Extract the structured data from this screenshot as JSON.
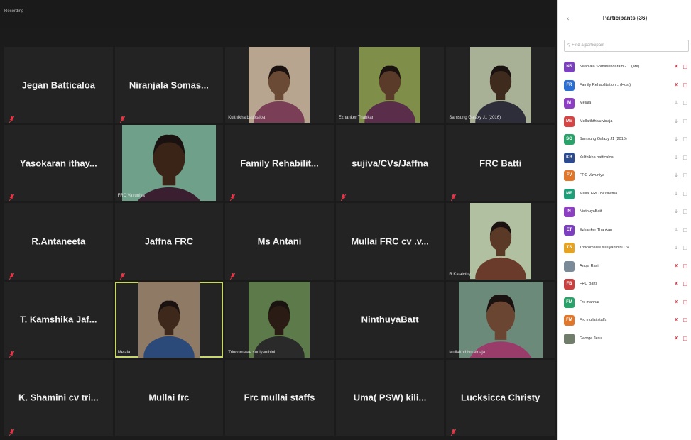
{
  "topbar": {
    "recording_label": "Recording"
  },
  "tiles": [
    {
      "name": "Jegan Batticaloa",
      "caption": "",
      "video": false,
      "muted": true
    },
    {
      "name": "Niranjala  Somas...",
      "caption": "",
      "video": false,
      "muted": true
    },
    {
      "name": "",
      "caption": "Kulthikha  batticaloa",
      "video": true,
      "muted": false,
      "skin": "#6a4a35",
      "bg": "#b8a58f",
      "shirt": "#7a3f57",
      "size": "narrow"
    },
    {
      "name": "",
      "caption": "Ezhanker Thankan",
      "video": true,
      "muted": false,
      "skin": "#5a3a28",
      "bg": "#7f8f4a",
      "shirt": "#5a2d4a",
      "size": "narrow"
    },
    {
      "name": "",
      "caption": "Samsung Galaxy J1 (2016)",
      "video": true,
      "muted": false,
      "skin": "#3f2a1e",
      "bg": "#a8b095",
      "shirt": "#2e2e3a",
      "size": "narrow"
    },
    {
      "name": "Yasokaran  ithay...",
      "caption": "",
      "video": false,
      "muted": true
    },
    {
      "name": "",
      "caption": "FRC Vavuniya",
      "video": true,
      "muted": false,
      "skin": "#3a2418",
      "bg": "#6fa08a",
      "shirt": "#3a1f30",
      "size": "wide"
    },
    {
      "name": "Family  Rehabilit...",
      "caption": "",
      "video": false,
      "muted": true
    },
    {
      "name": "sujiva/CVs/Jaffna",
      "caption": "",
      "video": false,
      "muted": true
    },
    {
      "name": "FRC Batti",
      "caption": "",
      "video": false,
      "muted": true
    },
    {
      "name": "R.Antaneeta",
      "caption": "",
      "video": false,
      "muted": true
    },
    {
      "name": "Jaffna FRC",
      "caption": "",
      "video": false,
      "muted": true
    },
    {
      "name": "Ms Antani",
      "caption": "",
      "video": false,
      "muted": true
    },
    {
      "name": "Mullai FRC cv .v...",
      "caption": "",
      "video": false,
      "muted": false
    },
    {
      "name": "",
      "caption": "R.Kalaivthy",
      "video": true,
      "muted": true,
      "skin": "#5a3a26",
      "bg": "#b0c0a0",
      "shirt": "#6a3a2a",
      "size": "narrow"
    },
    {
      "name": "T.  Kamshika  Jaf...",
      "caption": "",
      "video": false,
      "muted": true
    },
    {
      "name": "",
      "caption": "Melala",
      "video": true,
      "muted": false,
      "skin": "#3e281b",
      "bg": "#8f7a66",
      "shirt": "#2b4a7a",
      "size": "narrow",
      "active": true
    },
    {
      "name": "",
      "caption": "Trincomalee  suuiyanthini",
      "video": true,
      "muted": false,
      "skin": "#2a1c15",
      "bg": "#5d7a4a",
      "shirt": "#2a2a2a",
      "size": "narrow"
    },
    {
      "name": "NinthuyaBatt",
      "caption": "",
      "video": false,
      "muted": false
    },
    {
      "name": "",
      "caption": "Mullaiththivu vinaja",
      "video": true,
      "muted": false,
      "skin": "#6a4532",
      "bg": "#6c8a7a",
      "shirt": "#9a3c6a",
      "size": "mid"
    },
    {
      "name": "K.  Shamini  cv  tri...",
      "caption": "",
      "video": false,
      "muted": true
    },
    {
      "name": "Mullai frc",
      "caption": "",
      "video": false,
      "muted": false
    },
    {
      "name": "Frc mullai staffs",
      "caption": "",
      "video": false,
      "muted": false
    },
    {
      "name": "Uma( PSW)  kili...",
      "caption": "",
      "video": false,
      "muted": false
    },
    {
      "name": "Lucksicca Christy",
      "caption": "",
      "video": false,
      "muted": true
    }
  ],
  "panel": {
    "back_icon": "chevron-left-icon",
    "title": "Participants (36)",
    "search_placeholder": "Find a participant",
    "participants": [
      {
        "initials": "NS",
        "name": "Niranjala Somasundaram - ...  (Me)",
        "color": "#7b3fbf",
        "muted": true
      },
      {
        "initials": "FR",
        "name": "Family Rehabilitation...  (Host)",
        "color": "#2b6fd4",
        "muted": true
      },
      {
        "initials": "M",
        "name": "Melala",
        "color": "#8c3fc2",
        "muted": false
      },
      {
        "initials": "MV",
        "name": "Mullaiththivu vinaja",
        "color": "#d64545",
        "muted": false
      },
      {
        "initials": "SG",
        "name": "Samsung Galaxy J1 (2016)",
        "color": "#2aa36a",
        "muted": false
      },
      {
        "initials": "KB",
        "name": "Kulthikha  batticaloa",
        "color": "#2c4b8f",
        "muted": false
      },
      {
        "initials": "FV",
        "name": "FRC Vavuniya",
        "color": "#e0772a",
        "muted": false
      },
      {
        "initials": "MF",
        "name": "Mullai FRC cv vavitha",
        "color": "#1f9e7a",
        "muted": false
      },
      {
        "initials": "N",
        "name": "NinthuyaBatt",
        "color": "#8c3fc2",
        "muted": false
      },
      {
        "initials": "ET",
        "name": "Ezhanker Thankan",
        "color": "#7b3fbf",
        "muted": false
      },
      {
        "initials": "TS",
        "name": "Trincomalee suuiyanthini CV",
        "color": "#e6a323",
        "muted": false
      },
      {
        "initials": "",
        "name": "Anuja Ravi",
        "color": "#7a8a99",
        "muted": true
      },
      {
        "initials": "FB",
        "name": "FRC Batti",
        "color": "#c94040",
        "muted": true
      },
      {
        "initials": "FM",
        "name": "Frc mannar",
        "color": "#2aa36a",
        "muted": true
      },
      {
        "initials": "FM",
        "name": "Frc mullai staffs",
        "color": "#e0772a",
        "muted": true
      },
      {
        "initials": "",
        "name": "George Jesu",
        "color": "#6f7d6a",
        "muted": true
      }
    ]
  }
}
